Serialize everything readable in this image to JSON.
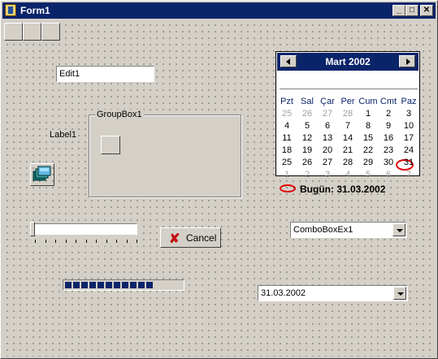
{
  "window": {
    "title": "Form1"
  },
  "title_buttons": {
    "minimize": "_",
    "maximize": "□",
    "close": "✕"
  },
  "edit1": {
    "value": "Edit1"
  },
  "label1": {
    "text": "Label1"
  },
  "groupbox1": {
    "caption": "GroupBox1"
  },
  "cancel_button": {
    "label": "Cancel",
    "icon": "cross-icon"
  },
  "trackbar": {
    "position": 0
  },
  "progress": {
    "percent": 70
  },
  "combobox_ex1": {
    "value": "ComboBoxEx1"
  },
  "date_picker": {
    "value": "31.03.2002"
  },
  "calendar": {
    "month_title": "Mart 2002",
    "weekdays": [
      "Pzt",
      "Sal",
      "Çar",
      "Per",
      "Cum",
      "Cmt",
      "Paz"
    ],
    "weeks": [
      [
        "25",
        "26",
        "27",
        "28",
        "1",
        "2",
        "3"
      ],
      [
        "4",
        "5",
        "6",
        "7",
        "8",
        "9",
        "10"
      ],
      [
        "11",
        "12",
        "13",
        "14",
        "15",
        "16",
        "17"
      ],
      [
        "18",
        "19",
        "20",
        "21",
        "22",
        "23",
        "24"
      ],
      [
        "25",
        "26",
        "27",
        "28",
        "29",
        "30",
        "31"
      ],
      [
        "1",
        "2",
        "3",
        "4",
        "5",
        "6",
        "7"
      ]
    ],
    "today_label": "Bugün: 31.03.2002",
    "accent": "#0a246a",
    "today_color": "#e00000"
  }
}
